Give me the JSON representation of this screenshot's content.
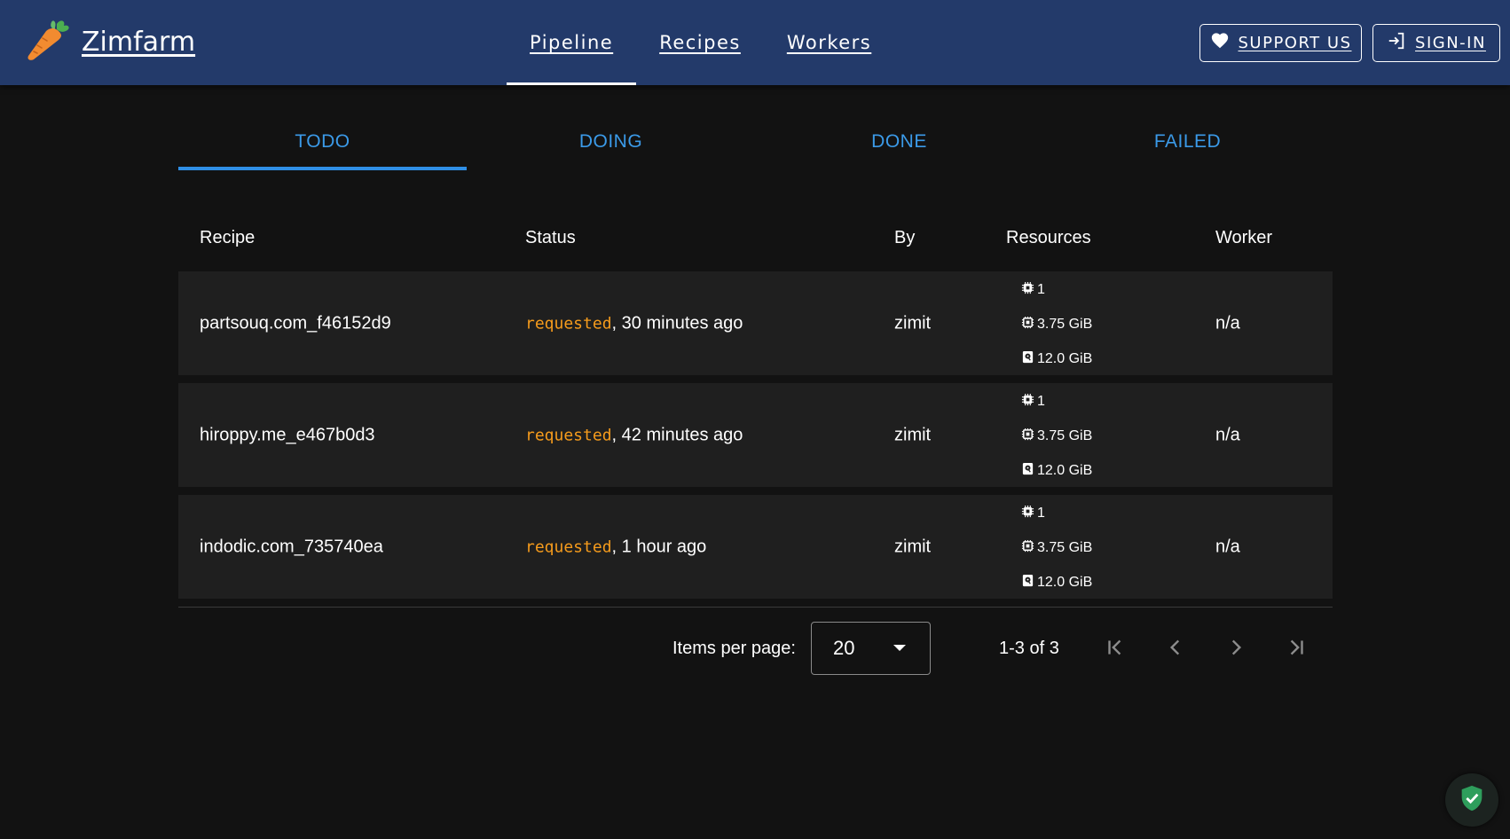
{
  "header": {
    "brand": "Zimfarm",
    "nav": [
      {
        "label": "Pipeline",
        "active": true
      },
      {
        "label": "Recipes",
        "active": false
      },
      {
        "label": "Workers",
        "active": false
      }
    ],
    "support_label": "SUPPORT US",
    "signin_label": "SIGN-IN"
  },
  "tabs": [
    {
      "label": "TODO",
      "active": true
    },
    {
      "label": "DOING",
      "active": false
    },
    {
      "label": "DONE",
      "active": false
    },
    {
      "label": "FAILED",
      "active": false
    }
  ],
  "table": {
    "columns": [
      "Recipe",
      "Status",
      "By",
      "Resources",
      "Worker"
    ],
    "rows": [
      {
        "recipe": "partsouq.com_f46152d9",
        "status": "requested",
        "time": ", 30 minutes ago",
        "by": "zimit",
        "cpu": "1",
        "memory": "3.75 GiB",
        "disk": "12.0 GiB",
        "worker": "n/a"
      },
      {
        "recipe": "hiroppy.me_e467b0d3",
        "status": "requested",
        "time": ", 42 minutes ago",
        "by": "zimit",
        "cpu": "1",
        "memory": "3.75 GiB",
        "disk": "12.0 GiB",
        "worker": "n/a"
      },
      {
        "recipe": "indodic.com_735740ea",
        "status": "requested",
        "time": ", 1 hour ago",
        "by": "zimit",
        "cpu": "1",
        "memory": "3.75 GiB",
        "disk": "12.0 GiB",
        "worker": "n/a"
      }
    ]
  },
  "pagination": {
    "items_per_page_label": "Items per page:",
    "items_per_page": "20",
    "range": "1-3 of 3"
  },
  "icons": {
    "brand": "carrot-icon",
    "support": "heart-icon",
    "signin": "login-icon",
    "cpu": "cpu-icon",
    "memory": "memory-icon",
    "disk": "disk-icon",
    "first": "first-page-icon",
    "prev": "chevron-left-icon",
    "next": "chevron-right-icon",
    "last": "last-page-icon",
    "badge": "shield-check-icon"
  },
  "colors": {
    "appbar": "#233a6a",
    "background": "#121212",
    "row": "#1f1f1f",
    "tab_accent": "#3b9ae8",
    "status_requested": "#f59b1c",
    "shield": "#2e9e5c"
  }
}
